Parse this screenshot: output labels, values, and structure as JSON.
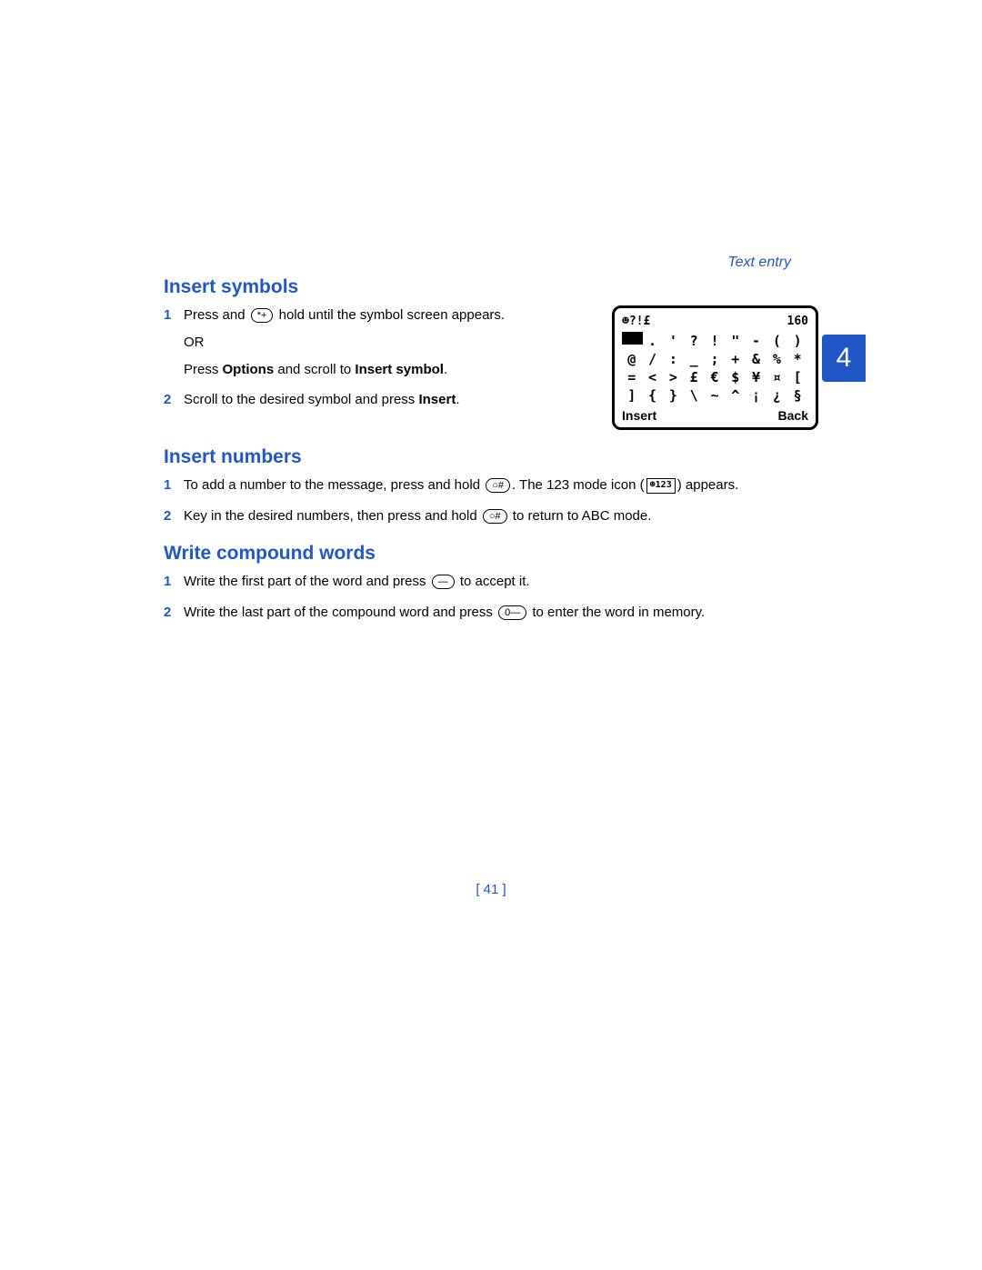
{
  "header": {
    "label": "Text entry"
  },
  "chapter": {
    "number": "4"
  },
  "page_number": "[ 41 ]",
  "phone_screen": {
    "top_left": "☻?!£",
    "top_right": "160",
    "rows": [
      [
        "■",
        ".",
        "'",
        "?",
        "!",
        "\"",
        "-",
        "(",
        ")"
      ],
      [
        "@",
        "/",
        ":",
        "_",
        ";",
        "+",
        "&",
        "%",
        "*"
      ],
      [
        "=",
        "<",
        ">",
        "£",
        "€",
        "$",
        "¥",
        "¤",
        "["
      ],
      [
        "]",
        "{",
        "}",
        "\\",
        "~",
        "^",
        "¡",
        "¿",
        "§"
      ]
    ],
    "bottom_left": "Insert",
    "bottom_right": "Back"
  },
  "sections": {
    "symbols": {
      "title": "Insert symbols",
      "step1a_pre": "Press and ",
      "step1a_key": "*+",
      "step1a_post": " hold until the symbol screen appears.",
      "or": "OR",
      "step1b_pre": "Press ",
      "step1b_bold1": "Options",
      "step1b_mid": " and scroll to ",
      "step1b_bold2": "Insert symbol",
      "step1b_post": ".",
      "step2_pre": "Scroll to the desired symbol and press ",
      "step2_bold": "Insert",
      "step2_post": "."
    },
    "numbers": {
      "title": "Insert numbers",
      "step1_pre": "To add a number to the message, press and hold ",
      "step1_key": "○#",
      "step1_post1": ". The 123 mode icon (",
      "step1_icon": "☻123",
      "step1_post2": ") appears.",
      "step2_pre": "Key in the desired numbers, then press and hold ",
      "step2_key": "○#",
      "step2_post": " to return to ABC mode."
    },
    "compound": {
      "title": "Write compound words",
      "step1_pre": "Write the first part of the word and press ",
      "step1_key": "―",
      "step1_post": " to accept it.",
      "step2_pre": "Write the last part of the compound word and press ",
      "step2_key": "0―",
      "step2_post": " to enter the word in memory."
    }
  }
}
